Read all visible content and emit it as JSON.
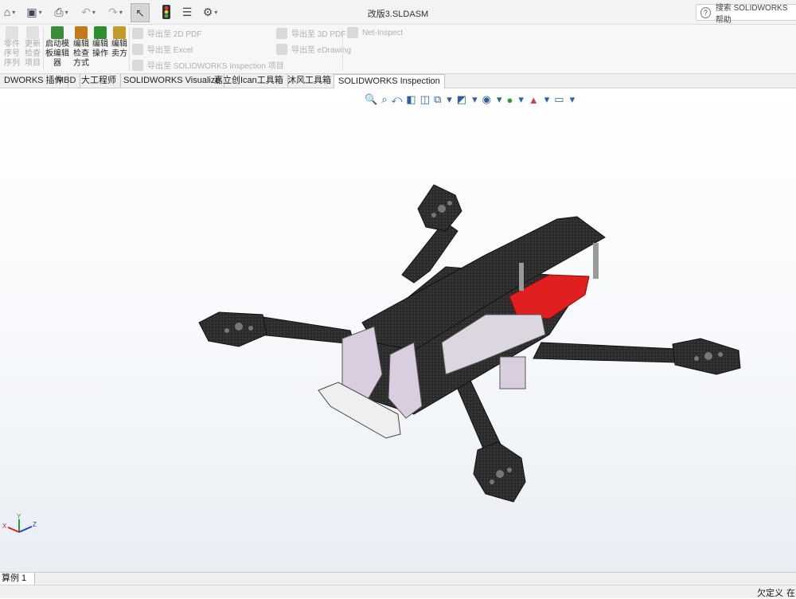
{
  "window": {
    "title": "改版3.SLDASM"
  },
  "quick_access": {
    "icons": [
      "open-icon",
      "save-icon",
      "print-icon",
      "undo-icon",
      "redo-icon",
      "select-arrow-icon",
      "traffic-light-icon",
      "file-properties-icon",
      "options-gear-icon"
    ]
  },
  "search": {
    "placeholder": "搜索 SOLIDWORKS 帮助"
  },
  "ribbon": {
    "left_cols": [
      {
        "lines": [
          "零件",
          "序号",
          "序列"
        ]
      },
      {
        "lines": [
          "更新",
          "检查",
          "项目"
        ]
      }
    ],
    "main_cols": [
      {
        "lines": [
          "启动模",
          "板编辑",
          "器"
        ],
        "color": "#3a8c3a"
      },
      {
        "lines": [
          "编辑",
          "检查",
          "方式"
        ],
        "color": "#c47a19"
      },
      {
        "lines": [
          "编辑",
          "操作"
        ],
        "color": "#2f8f2f"
      },
      {
        "lines": [
          "编辑",
          "卖方"
        ],
        "color": "#c49a2a"
      }
    ],
    "export_2d_pdf": "导出至 2D PDF",
    "export_excel": "导出至 Excel",
    "export_inspection": "导出至 SOLIDWORKS Inspection 项目",
    "export_3d_pdf": "导出至 3D PDF",
    "export_edrawing": "导出至 eDrawing",
    "net_inspect": "Net-Inspect"
  },
  "tabs": [
    {
      "label": "DWORKS 插件"
    },
    {
      "label": "MBD"
    },
    {
      "label": "大工程师"
    },
    {
      "label": "SOLIDWORKS Visualize"
    },
    {
      "label": "嘉立创Ican工具箱"
    },
    {
      "label": "沐风工具箱"
    },
    {
      "label": "SOLIDWORKS Inspection",
      "active": true
    }
  ],
  "view_toolbar": {
    "icons": [
      "zoom-to-fit-icon",
      "zoom-area-icon",
      "previous-view-icon",
      "section-view-icon",
      "dynamic-annotation-icon",
      "view-orientation-icon",
      "display-style-icon",
      "hide-show-icon",
      "edit-appearance-icon",
      "apply-scene-icon",
      "view-settings-icon"
    ]
  },
  "model": {
    "accent": "#e02020",
    "frame": "#2a2a2a",
    "mount": "#d9cde0"
  },
  "status": {
    "sheet_tab": "算例 1",
    "state": "欠定义",
    "editing": "在"
  }
}
